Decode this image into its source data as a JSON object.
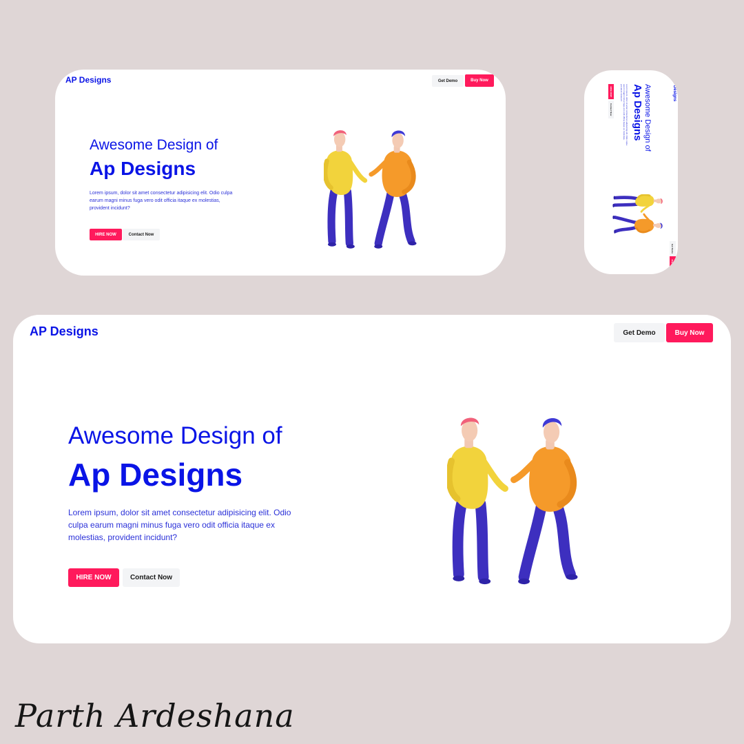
{
  "brand": "AP Designs",
  "header": {
    "demo_label": "Get Demo",
    "buy_label": "Buy Now"
  },
  "hero": {
    "title_line1": "Awesome Design of",
    "title_line2": "Ap Designs",
    "body": "Lorem ipsum, dolor sit amet consectetur adipisicing elit. Odio culpa earum magni minus fuga vero odit officia itaque ex molestias, provident incidunt?",
    "hire_label": "HIRE NOW",
    "contact_label": "Contact Now"
  },
  "signature": "Parth Ardeshana",
  "colors": {
    "background": "#dfd6d6",
    "brand_blue": "#0a14e6",
    "accent_pink": "#ff1a5c",
    "neutral_button": "#f3f4f6"
  },
  "illustration": {
    "icon": "two-characters-illustration"
  }
}
